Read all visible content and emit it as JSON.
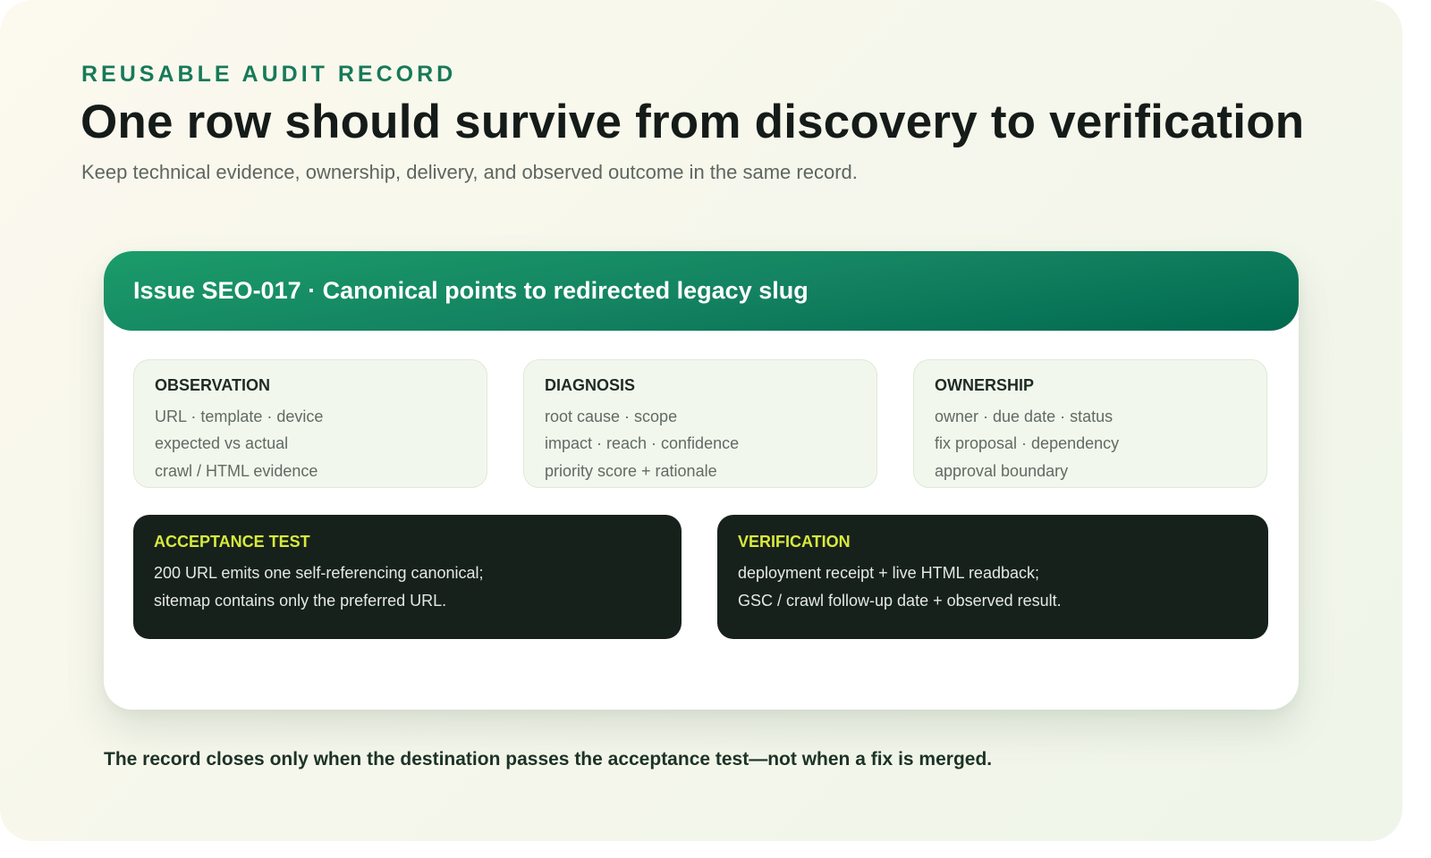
{
  "header": {
    "eyebrow": "REUSABLE AUDIT RECORD",
    "title": "One row should survive from discovery to verification",
    "subtitle": "Keep technical evidence, ownership, delivery, and observed outcome in the same record."
  },
  "record": {
    "title": "Issue SEO-017 · Canonical points to redirected legacy slug",
    "sections": [
      {
        "title": "OBSERVATION",
        "lines": [
          "URL · template · device",
          "expected vs actual",
          "crawl / HTML evidence"
        ]
      },
      {
        "title": "DIAGNOSIS",
        "lines": [
          "root cause · scope",
          "impact · reach · confidence",
          "priority score + rationale"
        ]
      },
      {
        "title": "OWNERSHIP",
        "lines": [
          "owner · due date · status",
          "fix proposal · dependency",
          "approval boundary"
        ]
      }
    ],
    "acceptance_test": {
      "title": "ACCEPTANCE TEST",
      "lines": [
        "200 URL emits one self-referencing canonical;",
        "sitemap contains only the preferred URL."
      ]
    },
    "verification": {
      "title": "VERIFICATION",
      "lines": [
        "deployment receipt + live HTML readback;",
        "GSC / crawl follow-up date + observed result."
      ]
    }
  },
  "footer": {
    "note": "The record closes only when the destination passes the acceptance test—not when a fix is merged."
  },
  "colors": {
    "accent_green": "#177a59",
    "header_gradient_start": "#1b9c6a",
    "header_gradient_end": "#00694f",
    "dark_panel": "#17211c",
    "dark_panel_title": "#d8ea3c",
    "light_panel": "#f2f7ed"
  }
}
